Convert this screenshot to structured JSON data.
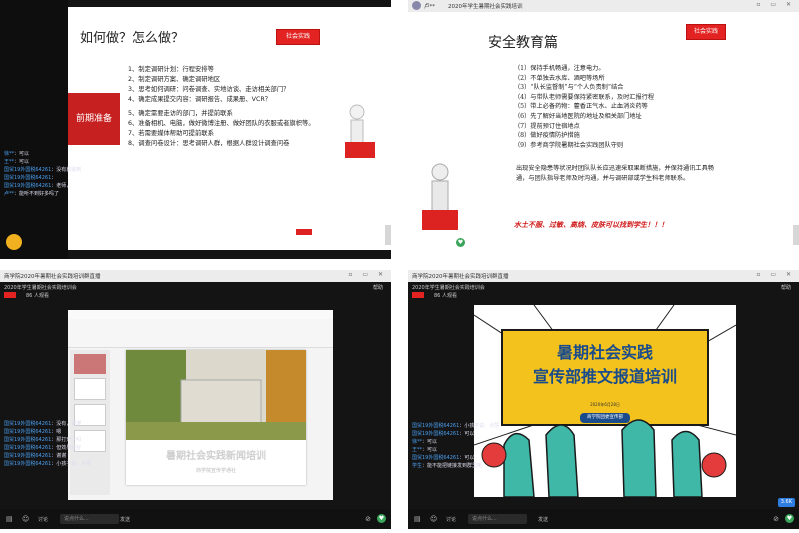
{
  "panel1": {
    "slide_title": "如何做？怎么做？",
    "badge": "社会实践",
    "section_label": "前期准备",
    "items": [
      "1、制定调研计划：行程安排等",
      "2、制定调研方案、确定调研地区",
      "3、思考如何调研：问卷调查、实地访谈、走访相关部门？",
      "4、确定成果提交内容：调研报告、成果册、VCR？",
      "5、确定需要走访的部门，并提前联系",
      "6、准备相机、电脑，做好微博注册、做好团队的衣服或者旗帜等。",
      "7、若需要媒体帮助可提前联系",
      "8、调查问卷设计：思考调研人群，根据人群设计调查问卷"
    ],
    "chat": [
      {
        "name": "徐**",
        "text": "可以"
      },
      {
        "name": "王**",
        "text": "可以"
      },
      {
        "name": "国贸19外国税64261",
        "text": "没有获取到"
      },
      {
        "name": "国贸19外国税64261",
        "text": ""
      },
      {
        "name": "国贸19外国税64261",
        "text": "老师，"
      },
      {
        "name": "卢**",
        "text": "能听不到好多吗了"
      }
    ]
  },
  "panel2": {
    "topbar_name": "卢**",
    "topbar_title": "2020年学生暑期社会实践培训",
    "slide_title": "安全教育篇",
    "badge": "社会实践",
    "items": [
      "（1）保持手机畅通，注意电力。",
      "（2）不单独去水库、酒吧等场所",
      "（3）“队长监督制”与“个人负责制”结合",
      "（4）与带队老师需要保持紧密联系，及时汇报行程",
      "（5）带上必备药物：藿香正气水、止血消炎药等",
      "（6）先了解好当地医院的地址及相关部门地址",
      "（7）提前预订住宿地点",
      "（8）做好疫情防护措施",
      "（9）参考商学院暑期社会实践团队守则"
    ],
    "paragraph": "出现安全隐患等状况时团队队长应迅速采取果断措施，并保持通讯工具畅通，与团队指导老师及时沟通，并与调研部或学生科老师联系。",
    "slogan": "水土不服、过敏、高烧、皮肤可以找到学生！！！"
  },
  "panel3": {
    "topbar_title": "商学院2020年暑期社会实践培训群直播",
    "subtitle": "2020年学生暑期社会实践培训会",
    "viewers": "86 人观看",
    "right_label": "帮助",
    "slide_title": "暑期社会实践新闻培训",
    "slide_sub": "商学院宣传学通社",
    "chat": [
      {
        "name": "国贸19外国税64261",
        "text": "没有，谢谢"
      },
      {
        "name": "国贸19外国税64261",
        "text": "嗯"
      },
      {
        "name": "国贸19外国税64261",
        "text": "那打开了吗"
      },
      {
        "name": "国贸19外国税64261",
        "text": "但效果还好"
      },
      {
        "name": "国贸19外国税64261",
        "text": "谢谢"
      },
      {
        "name": "国贸19外国税64261",
        "text": "小孩子说：点赞"
      }
    ],
    "bottom": {
      "label1": "讨论",
      "placeholder": "说点什么...",
      "send": "发送"
    }
  },
  "panel4": {
    "topbar_title": "商学院2020年暑期社会实践培训群直播",
    "subtitle": "2020年学生暑期社会实践培训会",
    "viewers": "86 人观看",
    "right_label": "帮助",
    "slide_line1": "暑期社会实践",
    "slide_line2": "宣传部推文报道培训",
    "slide_date": "2020年6月28日",
    "slide_org": "商学院团委宣传部",
    "chat": [
      {
        "name": "国贸19外国税64261",
        "text": "小孩子说：点赞"
      },
      {
        "name": "国贸19外国税64261",
        "text": "可以"
      },
      {
        "name": "徐**",
        "text": "可以"
      },
      {
        "name": "王**",
        "text": "可以"
      },
      {
        "name": "国贸19外国税64261",
        "text": "可以"
      },
      {
        "name": "学生",
        "text": "能不能把链接发到群里呢"
      }
    ],
    "bottom": {
      "label1": "讨论",
      "placeholder": "说点什么...",
      "send": "发送"
    },
    "corner_badge": "3.6K"
  },
  "colors": {
    "accent_red": "#e32222",
    "slide_yellow": "#f4c21c",
    "link_blue": "#4a9ff0"
  }
}
